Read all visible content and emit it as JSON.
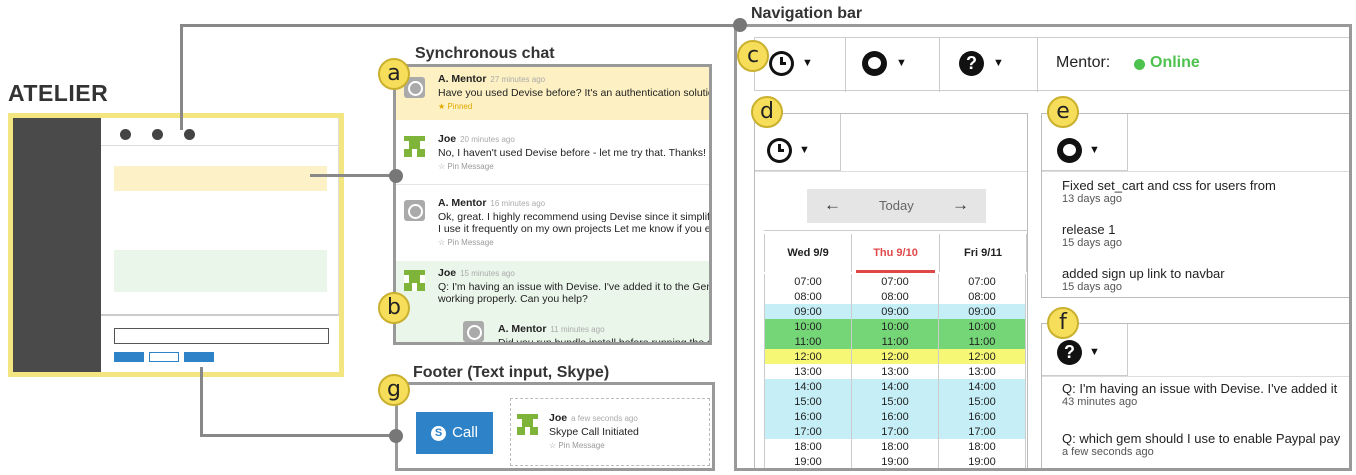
{
  "labels": {
    "atelier": "ATELIER",
    "chat": "Synchronous chat",
    "navbar": "Navigation bar",
    "footer": "Footer (Text input, Skype)"
  },
  "badges": {
    "a": "a",
    "b": "b",
    "c": "c",
    "d": "d",
    "e": "e",
    "f": "f",
    "g": "g"
  },
  "chat": {
    "pinned_label": "★ Pinned",
    "pin_message_label": "☆ Pin Message",
    "messages": [
      {
        "name": "A. Mentor",
        "time": "27 minutes ago",
        "lines": [
          "Have you used Devise before? It's an authentication solutio"
        ]
      },
      {
        "name": "Joe",
        "time": "20 minutes ago",
        "lines": [
          "No, I haven't used Devise before - let me try that. Thanks!"
        ]
      },
      {
        "name": "A. Mentor",
        "time": "16 minutes ago",
        "lines": [
          "Ok, great. I highly recommend using Devise since it simplifi",
          "I use it frequently on my own projects Let me know if you e"
        ]
      },
      {
        "name": "Joe",
        "time": "15 minutes ago",
        "lines": [
          "Q: I'm having an issue with Devise. I've added it to the Gem",
          "working properly. Can you help?"
        ]
      },
      {
        "name": "A. Mentor",
        "time": "11 minutes ago",
        "lines": [
          "Did you run bundle install before running the g"
        ]
      }
    ]
  },
  "footer": {
    "call_label": "Call",
    "message": {
      "name": "Joe",
      "time": "a few seconds ago",
      "text": "Skype Call Initiated",
      "pin": "☆ Pin Message"
    }
  },
  "navbar": {
    "mentor_label": "Mentor:",
    "status": "Online",
    "status_color": "#4ec24e"
  },
  "calendar": {
    "today_label": "Today",
    "days": [
      "Wed 9/9",
      "Thu 9/10",
      "Fri 9/11"
    ],
    "active_day_color": "#e04848",
    "times": [
      "07:00",
      "08:00",
      "09:00",
      "10:00",
      "11:00",
      "12:00",
      "13:00",
      "14:00",
      "15:00",
      "16:00",
      "17:00",
      "18:00",
      "19:00"
    ],
    "row_status": [
      "none",
      "none",
      "blue",
      "green",
      "green",
      "yellow",
      "none",
      "blue",
      "blue",
      "blue",
      "blue",
      "none",
      "none"
    ]
  },
  "github": {
    "commits": [
      {
        "text": "Fixed set_cart and css for users from",
        "time": "13 days ago"
      },
      {
        "text": "release 1",
        "time": "15 days ago"
      },
      {
        "text": "added sign up link to navbar",
        "time": "15 days ago"
      }
    ]
  },
  "questions": {
    "items": [
      {
        "text": "Q: I'm having an issue with Devise. I've added it",
        "time": "43 minutes ago"
      },
      {
        "text": "Q: which gem should I use to enable Paypal pay",
        "time": "a few seconds ago"
      }
    ]
  }
}
